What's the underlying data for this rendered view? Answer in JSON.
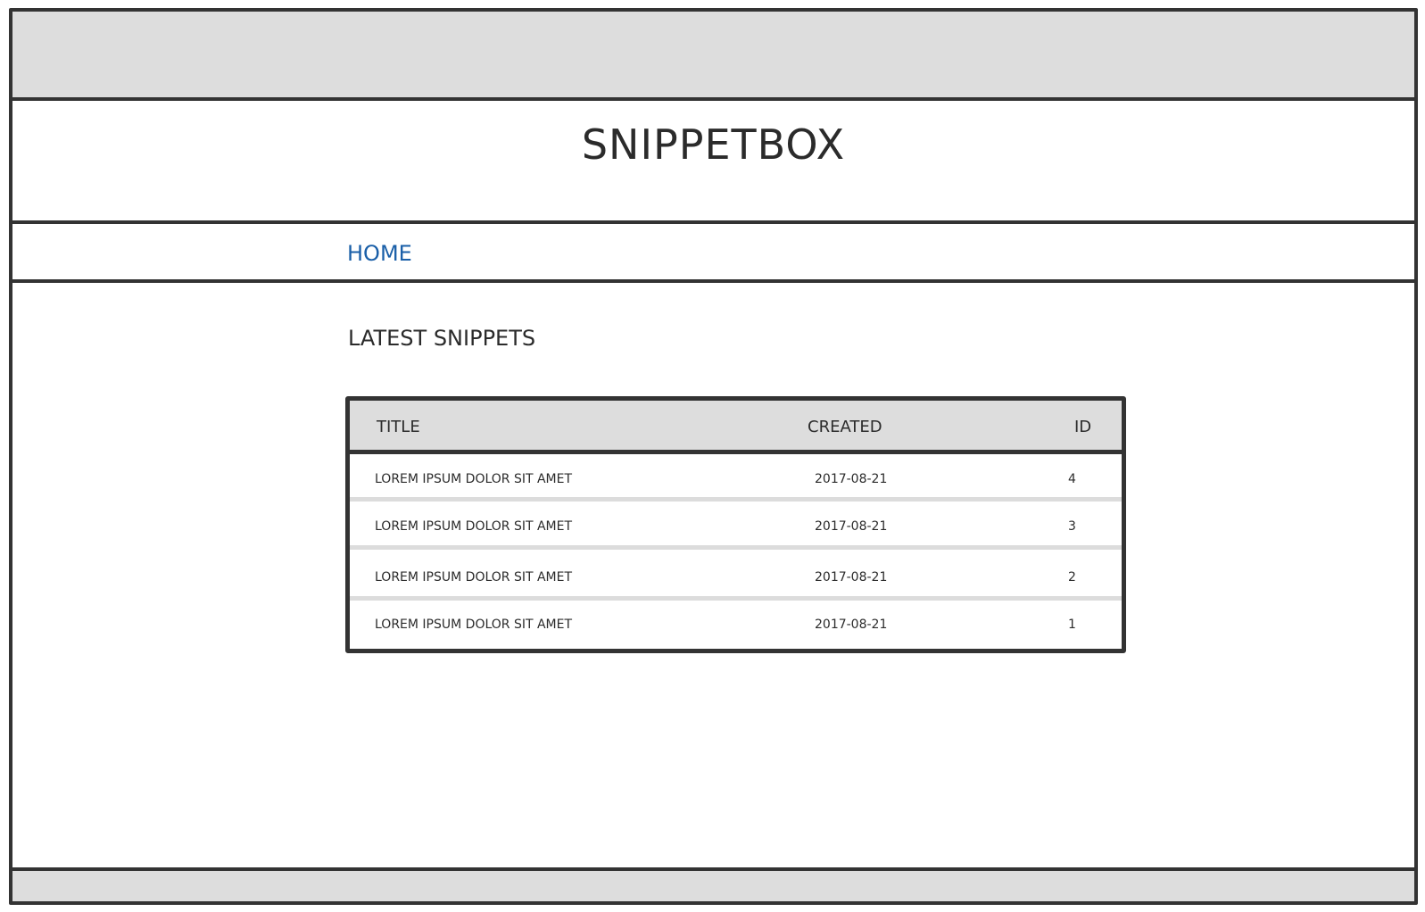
{
  "header": {
    "title": "SNIPPETBOX"
  },
  "nav": {
    "home_label": "HOME"
  },
  "main": {
    "heading": "LATEST SNIPPETS",
    "table": {
      "columns": [
        "TITLE",
        "CREATED",
        "ID"
      ],
      "rows": [
        {
          "title": "LOREM IPSUM DOLOR SIT AMET",
          "created": "2017-08-21",
          "id": "4"
        },
        {
          "title": "LOREM IPSUM DOLOR SIT AMET",
          "created": "2017-08-21",
          "id": "3"
        },
        {
          "title": "LOREM IPSUM DOLOR SIT AMET",
          "created": "2017-08-21",
          "id": "2"
        },
        {
          "title": "LOREM IPSUM DOLOR SIT AMET",
          "created": "2017-08-21",
          "id": "1"
        }
      ]
    }
  },
  "colors": {
    "link": "#1a5fa8",
    "bar": "#dddddd",
    "border": "#333333"
  }
}
